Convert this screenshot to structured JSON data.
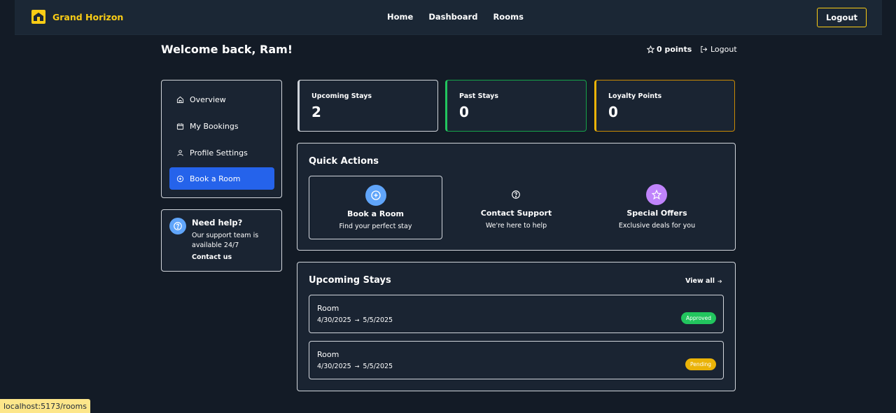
{
  "brand": {
    "name": "Grand Horizon"
  },
  "nav": {
    "items": [
      "Home",
      "Dashboard",
      "Rooms"
    ],
    "logout": "Logout"
  },
  "header": {
    "welcome": "Welcome back, Ram!",
    "points": "0 points",
    "logout": "Logout"
  },
  "sidebar": {
    "items": [
      {
        "label": "Overview",
        "icon": "home-icon"
      },
      {
        "label": "My Bookings",
        "icon": "calendar-icon"
      },
      {
        "label": "Profile Settings",
        "icon": "user-icon"
      },
      {
        "label": "Book a Room",
        "icon": "plus-circle-icon",
        "active": true
      }
    ]
  },
  "help": {
    "title": "Need help?",
    "text": "Our support team is available 24/7",
    "link": "Contact us"
  },
  "stats": [
    {
      "label": "Upcoming Stays",
      "value": "2"
    },
    {
      "label": "Past Stays",
      "value": "0"
    },
    {
      "label": "Loyalty Points",
      "value": "0"
    }
  ],
  "quick_actions": {
    "title": "Quick Actions",
    "items": [
      {
        "title": "Book a Room",
        "subtitle": "Find your perfect stay",
        "icon": "plus-circle-icon"
      },
      {
        "title": "Contact Support",
        "subtitle": "We're here to help",
        "icon": "help-circle-icon"
      },
      {
        "title": "Special Offers",
        "subtitle": "Exclusive deals for you",
        "icon": "star-icon"
      }
    ]
  },
  "upcoming": {
    "title": "Upcoming Stays",
    "view_all": "View all",
    "stays": [
      {
        "room": "Room",
        "check_in": "4/30/2025",
        "check_out": "5/5/2025",
        "status": "Approved"
      },
      {
        "room": "Room",
        "check_in": "4/30/2025",
        "check_out": "5/5/2025",
        "status": "Pending"
      }
    ]
  },
  "statusbar": {
    "url": "localhost:5173/rooms"
  },
  "colors": {
    "accent": "#facc15",
    "primary": "#2563eb",
    "success": "#22c55e",
    "warning": "#eab308",
    "background": "#131b26"
  }
}
